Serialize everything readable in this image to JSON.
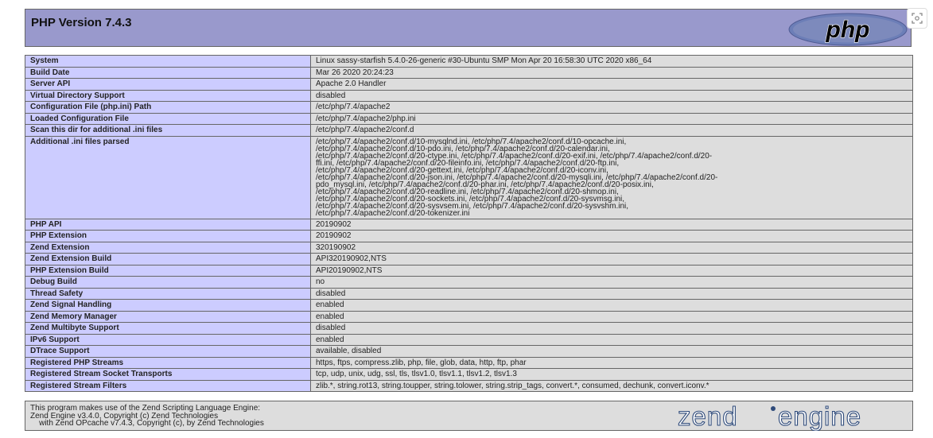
{
  "header": {
    "title": "PHP Version 7.4.3",
    "logo_text": "php"
  },
  "corner_button": {
    "icon": "screen-capture-icon"
  },
  "rows": [
    {
      "label": "System",
      "value": [
        "Linux sassy-starfish 5.4.0-26-generic #30-Ubuntu SMP Mon Apr 20 16:58:30 UTC 2020 x86_64"
      ]
    },
    {
      "label": "Build Date",
      "value": [
        "Mar 26 2020 20:24:23"
      ]
    },
    {
      "label": "Server API",
      "value": [
        "Apache 2.0 Handler"
      ]
    },
    {
      "label": "Virtual Directory Support",
      "value": [
        "disabled"
      ]
    },
    {
      "label": "Configuration File (php.ini) Path",
      "value": [
        "/etc/php/7.4/apache2"
      ]
    },
    {
      "label": "Loaded Configuration File",
      "value": [
        "/etc/php/7.4/apache2/php.ini"
      ]
    },
    {
      "label": "Scan this dir for additional .ini files",
      "value": [
        "/etc/php/7.4/apache2/conf.d"
      ]
    },
    {
      "label": "Additional .ini files parsed",
      "value": [
        "/etc/php/7.4/apache2/conf.d/10-mysqlnd.ini, /etc/php/7.4/apache2/conf.d/10-opcache.ini,",
        "/etc/php/7.4/apache2/conf.d/10-pdo.ini, /etc/php/7.4/apache2/conf.d/20-calendar.ini,",
        "/etc/php/7.4/apache2/conf.d/20-ctype.ini, /etc/php/7.4/apache2/conf.d/20-exif.ini, /etc/php/7.4/apache2/conf.d/20-",
        "ffi.ini, /etc/php/7.4/apache2/conf.d/20-fileinfo.ini, /etc/php/7.4/apache2/conf.d/20-ftp.ini,",
        "/etc/php/7.4/apache2/conf.d/20-gettext.ini, /etc/php/7.4/apache2/conf.d/20-iconv.ini,",
        "/etc/php/7.4/apache2/conf.d/20-json.ini, /etc/php/7.4/apache2/conf.d/20-mysqli.ini, /etc/php/7.4/apache2/conf.d/20-",
        "pdo_mysql.ini, /etc/php/7.4/apache2/conf.d/20-phar.ini, /etc/php/7.4/apache2/conf.d/20-posix.ini,",
        "/etc/php/7.4/apache2/conf.d/20-readline.ini, /etc/php/7.4/apache2/conf.d/20-shmop.ini,",
        "/etc/php/7.4/apache2/conf.d/20-sockets.ini, /etc/php/7.4/apache2/conf.d/20-sysvmsg.ini,",
        "/etc/php/7.4/apache2/conf.d/20-sysvsem.ini, /etc/php/7.4/apache2/conf.d/20-sysvshm.ini,",
        "/etc/php/7.4/apache2/conf.d/20-tokenizer.ini"
      ]
    },
    {
      "label": "PHP API",
      "value": [
        "20190902"
      ]
    },
    {
      "label": "PHP Extension",
      "value": [
        "20190902"
      ]
    },
    {
      "label": "Zend Extension",
      "value": [
        "320190902"
      ]
    },
    {
      "label": "Zend Extension Build",
      "value": [
        "API320190902,NTS"
      ]
    },
    {
      "label": "PHP Extension Build",
      "value": [
        "API20190902,NTS"
      ]
    },
    {
      "label": "Debug Build",
      "value": [
        "no"
      ]
    },
    {
      "label": "Thread Safety",
      "value": [
        "disabled"
      ]
    },
    {
      "label": "Zend Signal Handling",
      "value": [
        "enabled"
      ]
    },
    {
      "label": "Zend Memory Manager",
      "value": [
        "enabled"
      ]
    },
    {
      "label": "Zend Multibyte Support",
      "value": [
        "disabled"
      ]
    },
    {
      "label": "IPv6 Support",
      "value": [
        "enabled"
      ]
    },
    {
      "label": "DTrace Support",
      "value": [
        "available, disabled"
      ]
    },
    {
      "label": "Registered PHP Streams",
      "value": [
        "https, ftps, compress.zlib, php, file, glob, data, http, ftp, phar"
      ]
    },
    {
      "label": "Registered Stream Socket Transports",
      "value": [
        "tcp, udp, unix, udg, ssl, tls, tlsv1.0, tlsv1.1, tlsv1.2, tlsv1.3"
      ]
    },
    {
      "label": "Registered Stream Filters",
      "value": [
        "zlib.*, string.rot13, string.toupper, string.tolower, string.strip_tags, convert.*, consumed, dechunk, convert.iconv.*"
      ]
    }
  ],
  "footer": {
    "lines": [
      "This program makes use of the Zend Scripting Language Engine:",
      "Zend Engine v3.4.0, Copyright (c) Zend Technologies",
      "    with Zend OPcache v7.4.3, Copyright (c), by Zend Technologies"
    ],
    "logo_word1": "zend",
    "logo_word2": "engine"
  },
  "colors": {
    "header_bg": "#9999cc",
    "label_bg": "#ccccff",
    "value_bg": "#dddddd",
    "border": "#666666"
  }
}
